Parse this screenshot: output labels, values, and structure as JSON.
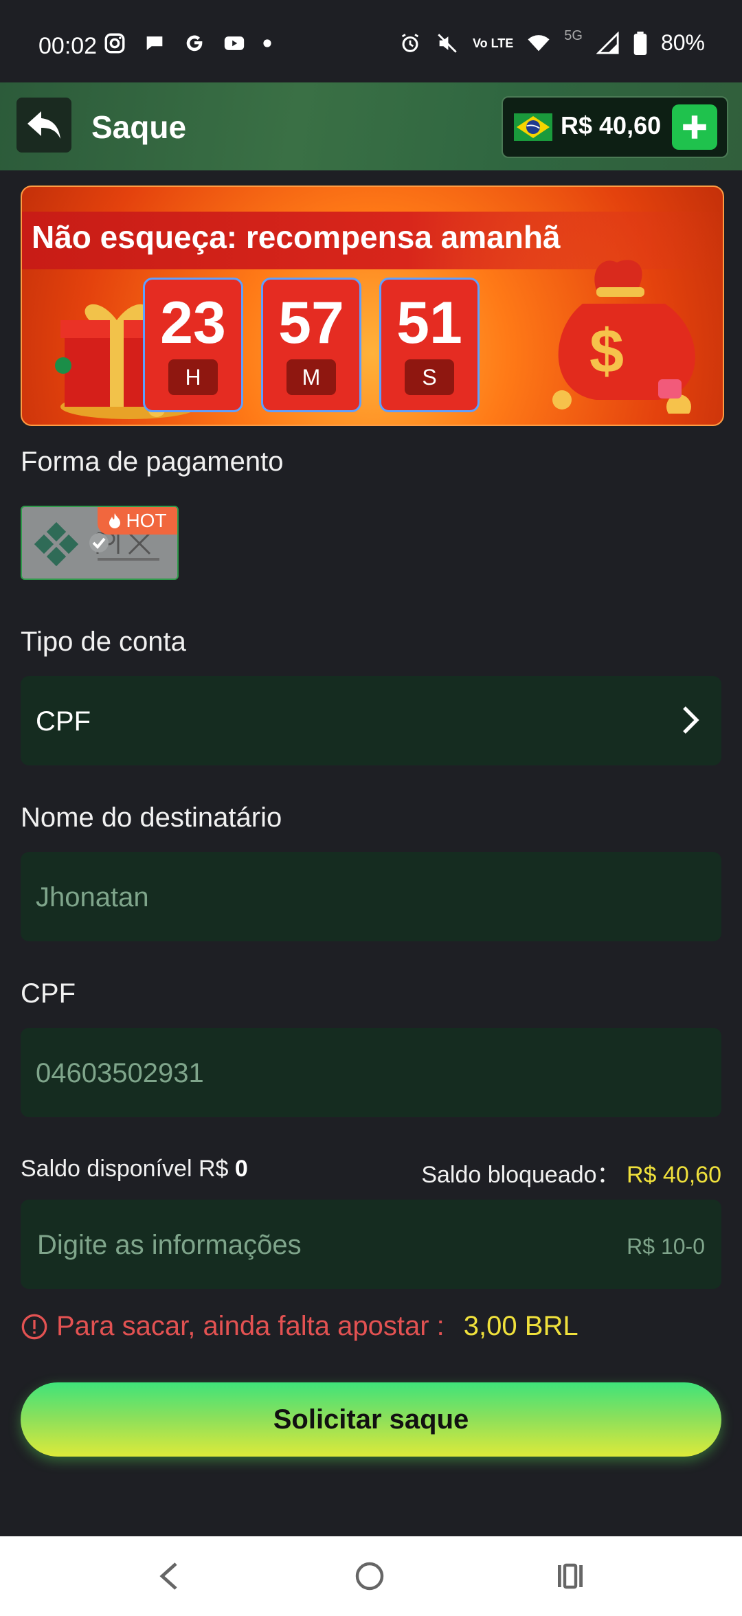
{
  "status_bar": {
    "time": "00:02",
    "network": "5G",
    "volte": "Vo LTE",
    "battery": "80%",
    "icons": [
      "instagram-icon",
      "chat-icon",
      "google-icon",
      "youtube-icon",
      "dot-icon",
      "alarm-icon",
      "mute-icon",
      "volte-icon",
      "wifi-icon",
      "signal-icon",
      "battery-icon"
    ]
  },
  "header": {
    "title": "Saque",
    "balance": "R$ 40,60",
    "back_icon": "back-arrow-icon",
    "add_icon": "plus-icon",
    "flag_icon": "brazil-flag-icon"
  },
  "banner": {
    "title": "Não esqueça: recompensa amanhã",
    "timer": [
      {
        "value": "23",
        "unit": "H"
      },
      {
        "value": "57",
        "unit": "M"
      },
      {
        "value": "51",
        "unit": "S"
      }
    ]
  },
  "payment": {
    "label": "Forma de pagamento",
    "method_badge": "HOT",
    "method_icon": "pix-logo-icon"
  },
  "account_type": {
    "label": "Tipo de conta",
    "value": "CPF"
  },
  "recipient": {
    "label": "Nome do destinatário",
    "value": "Jhonatan"
  },
  "cpf": {
    "label": "CPF",
    "value": "04603502931"
  },
  "amounts": {
    "available_label": "Saldo disponível R$",
    "available_value": "0",
    "blocked_label": "Saldo bloqueado：",
    "blocked_value": "R$ 40,60"
  },
  "amount_input": {
    "placeholder": "Digite as informações",
    "range": "R$ 10-0"
  },
  "warning": {
    "text": "Para sacar, ainda falta apostar :",
    "value": "3,00 BRL"
  },
  "submit": {
    "label": "Solicitar saque"
  },
  "colors": {
    "background": "#1e1f24",
    "field": "#152c20",
    "accent_green": "#1fc24d",
    "yellow": "#f0e13c",
    "error": "#e35252"
  }
}
